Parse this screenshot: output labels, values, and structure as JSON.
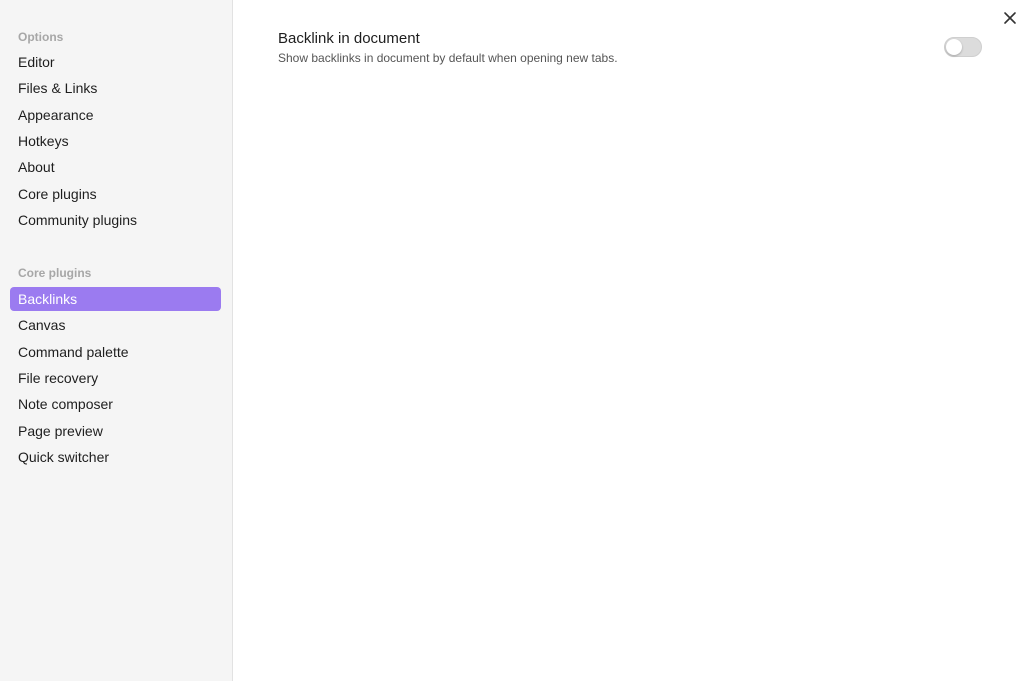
{
  "sidebar": {
    "options_heading": "Options",
    "options_items": [
      {
        "label": "Editor"
      },
      {
        "label": "Files & Links"
      },
      {
        "label": "Appearance"
      },
      {
        "label": "Hotkeys"
      },
      {
        "label": "About"
      },
      {
        "label": "Core plugins"
      },
      {
        "label": "Community plugins"
      }
    ],
    "core_heading": "Core plugins",
    "core_items": [
      {
        "label": "Backlinks",
        "active": true
      },
      {
        "label": "Canvas"
      },
      {
        "label": "Command palette"
      },
      {
        "label": "File recovery"
      },
      {
        "label": "Note composer"
      },
      {
        "label": "Page preview"
      },
      {
        "label": "Quick switcher"
      }
    ]
  },
  "setting": {
    "name": "Backlink in document",
    "description": "Show backlinks in document by default when opening new tabs.",
    "enabled": false
  },
  "icons": {
    "close": "close-icon"
  },
  "colors": {
    "accent": "#9b7bf0",
    "sidebar_bg": "#f5f5f5"
  }
}
